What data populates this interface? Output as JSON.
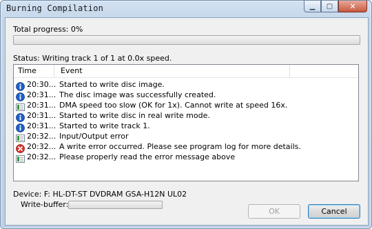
{
  "window": {
    "title": "Burning Compilation"
  },
  "caption_buttons": {
    "minimize": "▁",
    "maximize": "▢",
    "close": "✕"
  },
  "progress": {
    "label": "Total progress: 0%",
    "value_percent": 0
  },
  "status": {
    "text": "Status: Writing track 1 of 1 at 0.0x speed."
  },
  "log": {
    "columns": [
      "Time",
      "Event"
    ],
    "rows": [
      {
        "icon": "info-icon",
        "time": "20:30...",
        "event": "Started to write disc image."
      },
      {
        "icon": "info-icon",
        "time": "20:31...",
        "event": "The disc image was successfully created."
      },
      {
        "icon": "log-icon",
        "time": "20:31...",
        "event": "DMA speed too slow (OK for 1x). Cannot write at speed 16x."
      },
      {
        "icon": "info-icon",
        "time": "20:31...",
        "event": "Started to write disc in real write mode."
      },
      {
        "icon": "info-icon",
        "time": "20:31...",
        "event": "Started to write track 1."
      },
      {
        "icon": "log-icon",
        "time": "20:32...",
        "event": "Input/Output error"
      },
      {
        "icon": "error-icon",
        "time": "20:32...",
        "event": "A write error occurred. Please see program log for more details."
      },
      {
        "icon": "log-icon",
        "time": "20:32...",
        "event": "Please properly read the error message above"
      }
    ]
  },
  "device": {
    "text": "Device: F: HL-DT-ST DVDRAM GSA-H12N UL02"
  },
  "write_buffer": {
    "label": "Write-buffer:",
    "value_percent": 0
  },
  "buttons": {
    "ok": "OK",
    "cancel": "Cancel"
  }
}
